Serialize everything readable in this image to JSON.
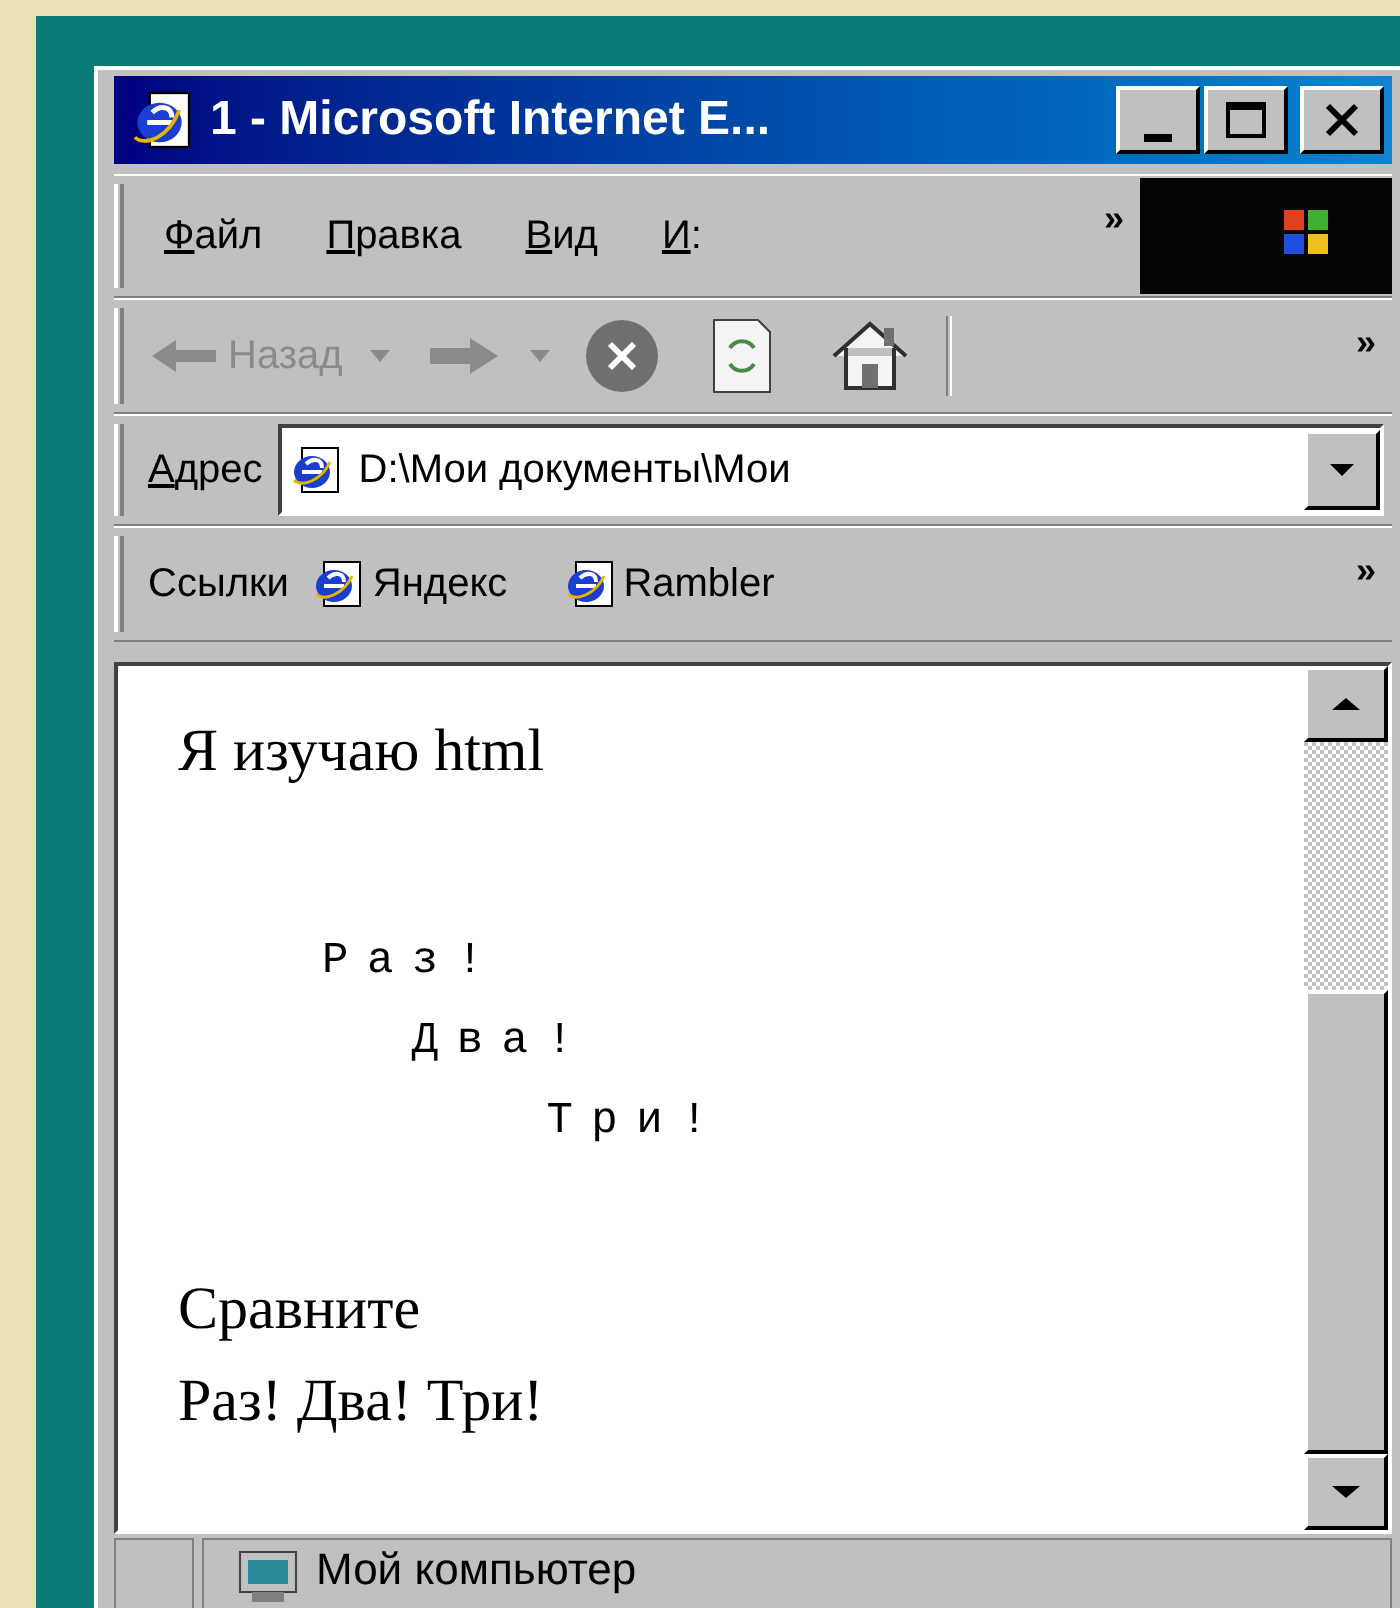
{
  "window": {
    "title": "1 - Microsoft Internet E..."
  },
  "menu": {
    "items": [
      {
        "accel": "Ф",
        "rest": "айл"
      },
      {
        "accel": "П",
        "rest": "равка"
      },
      {
        "accel": "В",
        "rest": "ид"
      },
      {
        "accel": "И",
        "rest": ":"
      }
    ],
    "overflow": "»"
  },
  "toolbar": {
    "back": {
      "label": "Назад",
      "disabled": true
    },
    "overflow": "»"
  },
  "address": {
    "accel": "А",
    "rest": "дрес",
    "value": "D:\\Мои документы\\Мои"
  },
  "links": {
    "label": "Ссылки",
    "items": [
      "Яндекс",
      "Rambler"
    ],
    "overflow": "»"
  },
  "content": {
    "heading": "Я изучаю html",
    "preformatted": "Раз!\n  Два!\n     Три!",
    "compare_label": "Сравните",
    "inline_text": "Раз! Два! Три!"
  },
  "status_bar": {
    "zone": "Мой компьютер"
  }
}
